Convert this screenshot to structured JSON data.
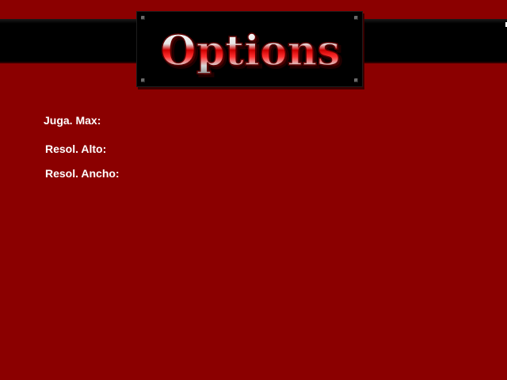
{
  "title": "Options",
  "colors": {
    "background": "#8b0000",
    "header_bar": "#000000",
    "label_text": "#ffffff",
    "logo_red": "#d40000",
    "logo_chrome": "#e6e6e6"
  },
  "options": {
    "max_players_label": "Juga. Max:",
    "resolution_height_label": "Resol. Alto:",
    "resolution_width_label": "Resol. Ancho:"
  }
}
